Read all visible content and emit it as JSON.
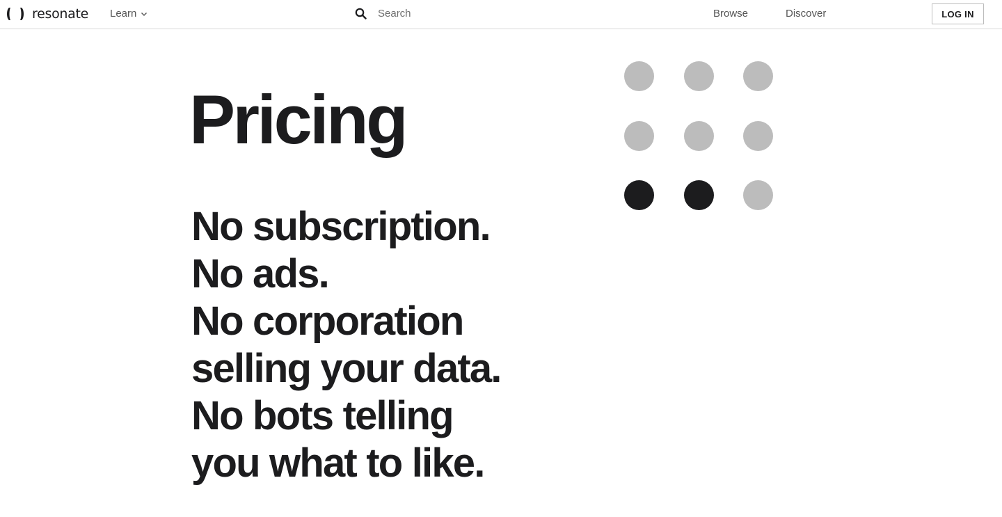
{
  "header": {
    "logo_text": "resonate",
    "learn_label": "Learn",
    "search_placeholder": "Search",
    "browse_label": "Browse",
    "discover_label": "Discover",
    "login_label": "LOG IN"
  },
  "hero": {
    "title": "Pricing",
    "lines": [
      "No subscription.",
      "No ads.",
      "No corporation",
      "selling your data.",
      "No bots telling",
      "you what to like."
    ]
  },
  "dot_grid": {
    "colors": {
      "filled": "#1c1c1e",
      "empty": "#bcbcbc"
    },
    "states": [
      "empty",
      "empty",
      "empty",
      "empty",
      "empty",
      "empty",
      "filled",
      "filled",
      "empty"
    ]
  }
}
